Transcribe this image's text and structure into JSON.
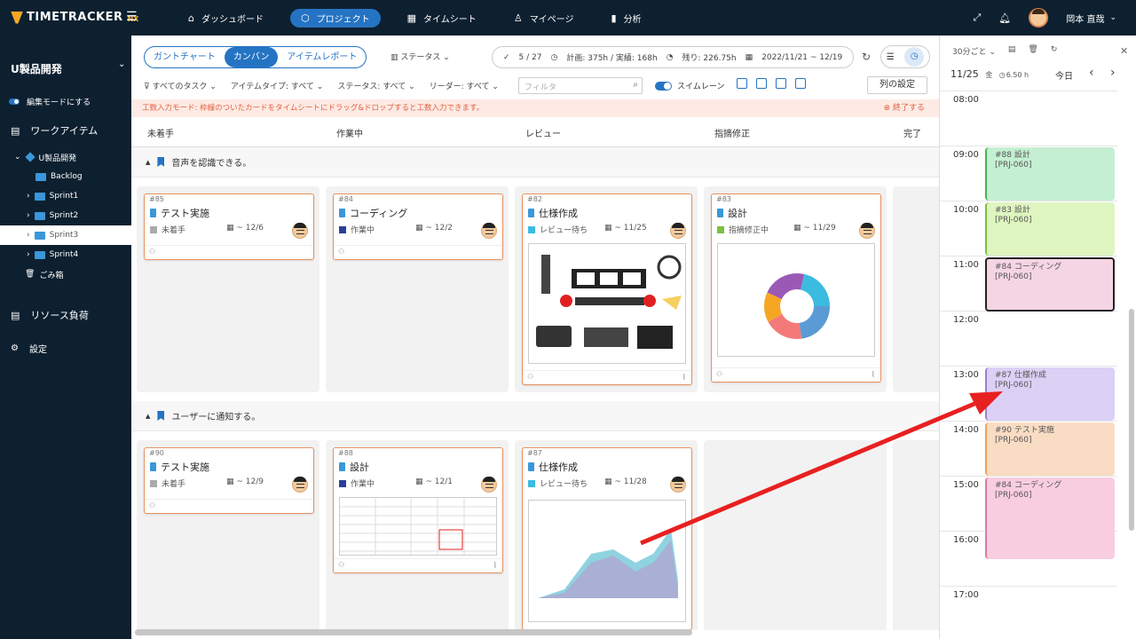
{
  "app": {
    "logo": "TIMETRACKER",
    "logo_suffix": "NX"
  },
  "nav": [
    {
      "label": "ダッシュボード",
      "icon": "home-icon"
    },
    {
      "label": "プロジェクト",
      "icon": "cube-icon",
      "active": true
    },
    {
      "label": "タイムシート",
      "icon": "calendar-icon"
    },
    {
      "label": "マイページ",
      "icon": "user-icon"
    },
    {
      "label": "分析",
      "icon": "bar-chart-icon"
    }
  ],
  "user": {
    "name": "岡本 直哉"
  },
  "sidebar": {
    "project": "U製品開発",
    "edit_mode": "編集モードにする",
    "work_items": "ワークアイテム",
    "tree": [
      {
        "label": "U製品開発"
      },
      {
        "label": "Backlog"
      },
      {
        "label": "Sprint1"
      },
      {
        "label": "Sprint2"
      },
      {
        "label": "Sprint3"
      },
      {
        "label": "Sprint4"
      },
      {
        "label": "ごみ箱"
      }
    ],
    "resources": "リソース負荷",
    "settings": "設定"
  },
  "toolbar": {
    "tabs": [
      "ガントチャート",
      "カンバン",
      "アイテムレポート"
    ],
    "status_dropdown": "ステータス",
    "count": "5 / 27",
    "plan": "計画: 375h / 実績: 168h",
    "remain": "残り: 226.75h",
    "range": "2022/11/21 ~ 12/19",
    "filters": [
      "すべてのタスク",
      "アイテムタイプ: すべて",
      "ステータス: すべて",
      "リーダー: すべて"
    ],
    "filter_placeholder": "フィルタ",
    "swimlane": "スイムレーン",
    "column_settings": "列の設定"
  },
  "banner": {
    "text": "工数入力モード: 枠線のついたカードをタイムシートにドラッグ&ドロップすると工数入力できます。",
    "end": "終了する"
  },
  "columns": [
    "未着手",
    "作業中",
    "レビュー",
    "指摘修正",
    "完了"
  ],
  "lanes": [
    {
      "title": "音声を認識できる。",
      "cards": [
        {
          "id": "#85",
          "title": "テスト実施",
          "status": "未着手",
          "status_color": "#aaaaaa",
          "due": "~ 12/6"
        },
        {
          "id": "#84",
          "title": "コーディング",
          "status": "作業中",
          "status_color": "#2b3f9a",
          "due": "~ 12/2"
        },
        {
          "id": "#82",
          "title": "仕様作成",
          "status": "レビュー待ち",
          "status_color": "#3bbbe0",
          "due": "~ 11/25"
        },
        {
          "id": "#83",
          "title": "設計",
          "status": "指摘修正中",
          "status_color": "#7cc040",
          "due": "~ 11/29"
        }
      ]
    },
    {
      "title": "ユーザーに通知する。",
      "cards": [
        {
          "id": "#90",
          "title": "テスト実施",
          "status": "未着手",
          "status_color": "#aaaaaa",
          "due": "~ 12/9"
        },
        {
          "id": "#88",
          "title": "設計",
          "status": "作業中",
          "status_color": "#2b3f9a",
          "due": "~ 12/1"
        },
        {
          "id": "#87",
          "title": "仕様作成",
          "status": "レビュー待ち",
          "status_color": "#3bbbe0",
          "due": "~ 11/28"
        }
      ]
    }
  ],
  "calendar": {
    "interval": "30分ごと",
    "date": "11/25",
    "weekday": "金",
    "hours_total": "6.50 h",
    "today": "今日",
    "hours": [
      "08:00",
      "09:00",
      "10:00",
      "11:00",
      "12:00",
      "13:00",
      "14:00",
      "15:00",
      "16:00",
      "17:00"
    ],
    "events": [
      {
        "title": "#88 設計",
        "project": "[PRJ-060]",
        "color": "#c5efd2"
      },
      {
        "title": "#83 設計",
        "project": "[PRJ-060]",
        "color": "#dff5c0"
      },
      {
        "title": "#84 コーディング",
        "project": "[PRJ-060]",
        "color": "#f5d5e3"
      },
      {
        "title": "#87 仕様作成",
        "project": "[PRJ-060]",
        "color": "#ddd0f5"
      },
      {
        "title": "#90 テスト実施",
        "project": "[PRJ-060]",
        "color": "#f9dcc4"
      },
      {
        "title": "#84 コーディング",
        "project": "[PRJ-060]",
        "color": "#f9cde0"
      }
    ]
  },
  "colors": {
    "primary": "#2574c4",
    "dark": "#0d2030",
    "card_border": "#e8925e",
    "arrow": "#e82020"
  }
}
